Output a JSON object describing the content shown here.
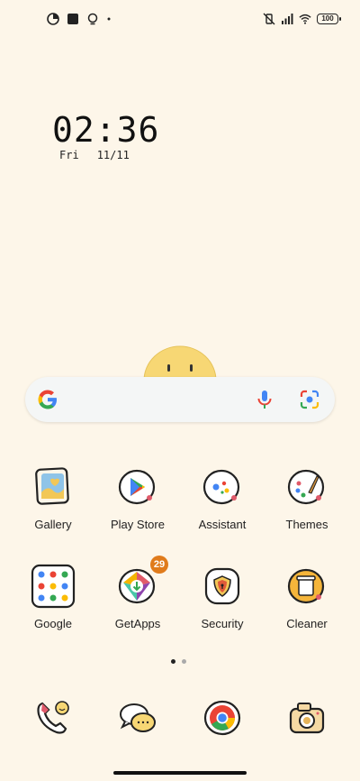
{
  "status_bar": {
    "left_icons": [
      "app-notification-icon",
      "square-notification-icon",
      "bulb-notification-icon",
      "dot-icon"
    ],
    "right_icons": [
      "vibrate-icon",
      "signal-icon",
      "wifi-icon"
    ],
    "battery": "100"
  },
  "clock": {
    "time": "02:36",
    "day": "Fri",
    "date": "11/11"
  },
  "search": {
    "logo": "google-g-icon",
    "mic": "mic-icon",
    "lens": "camera-lens-icon"
  },
  "apps": [
    {
      "label": "Gallery",
      "icon": "gallery-icon"
    },
    {
      "label": "Play Store",
      "icon": "play-store-icon"
    },
    {
      "label": "Assistant",
      "icon": "assistant-icon"
    },
    {
      "label": "Themes",
      "icon": "themes-icon"
    },
    {
      "label": "Google",
      "icon": "google-folder-icon"
    },
    {
      "label": "GetApps",
      "icon": "getapps-icon",
      "badge": "29"
    },
    {
      "label": "Security",
      "icon": "security-icon"
    },
    {
      "label": "Cleaner",
      "icon": "cleaner-icon"
    }
  ],
  "dock": [
    {
      "icon": "phone-icon"
    },
    {
      "icon": "messages-icon"
    },
    {
      "icon": "chrome-icon"
    },
    {
      "icon": "camera-icon"
    }
  ],
  "pages": {
    "count": 2,
    "current": 1
  },
  "colors": {
    "background": "#fdf6e9",
    "accent": "#e07b1b",
    "dot_active": "#222222",
    "dot_inactive": "#aaaaaa"
  }
}
